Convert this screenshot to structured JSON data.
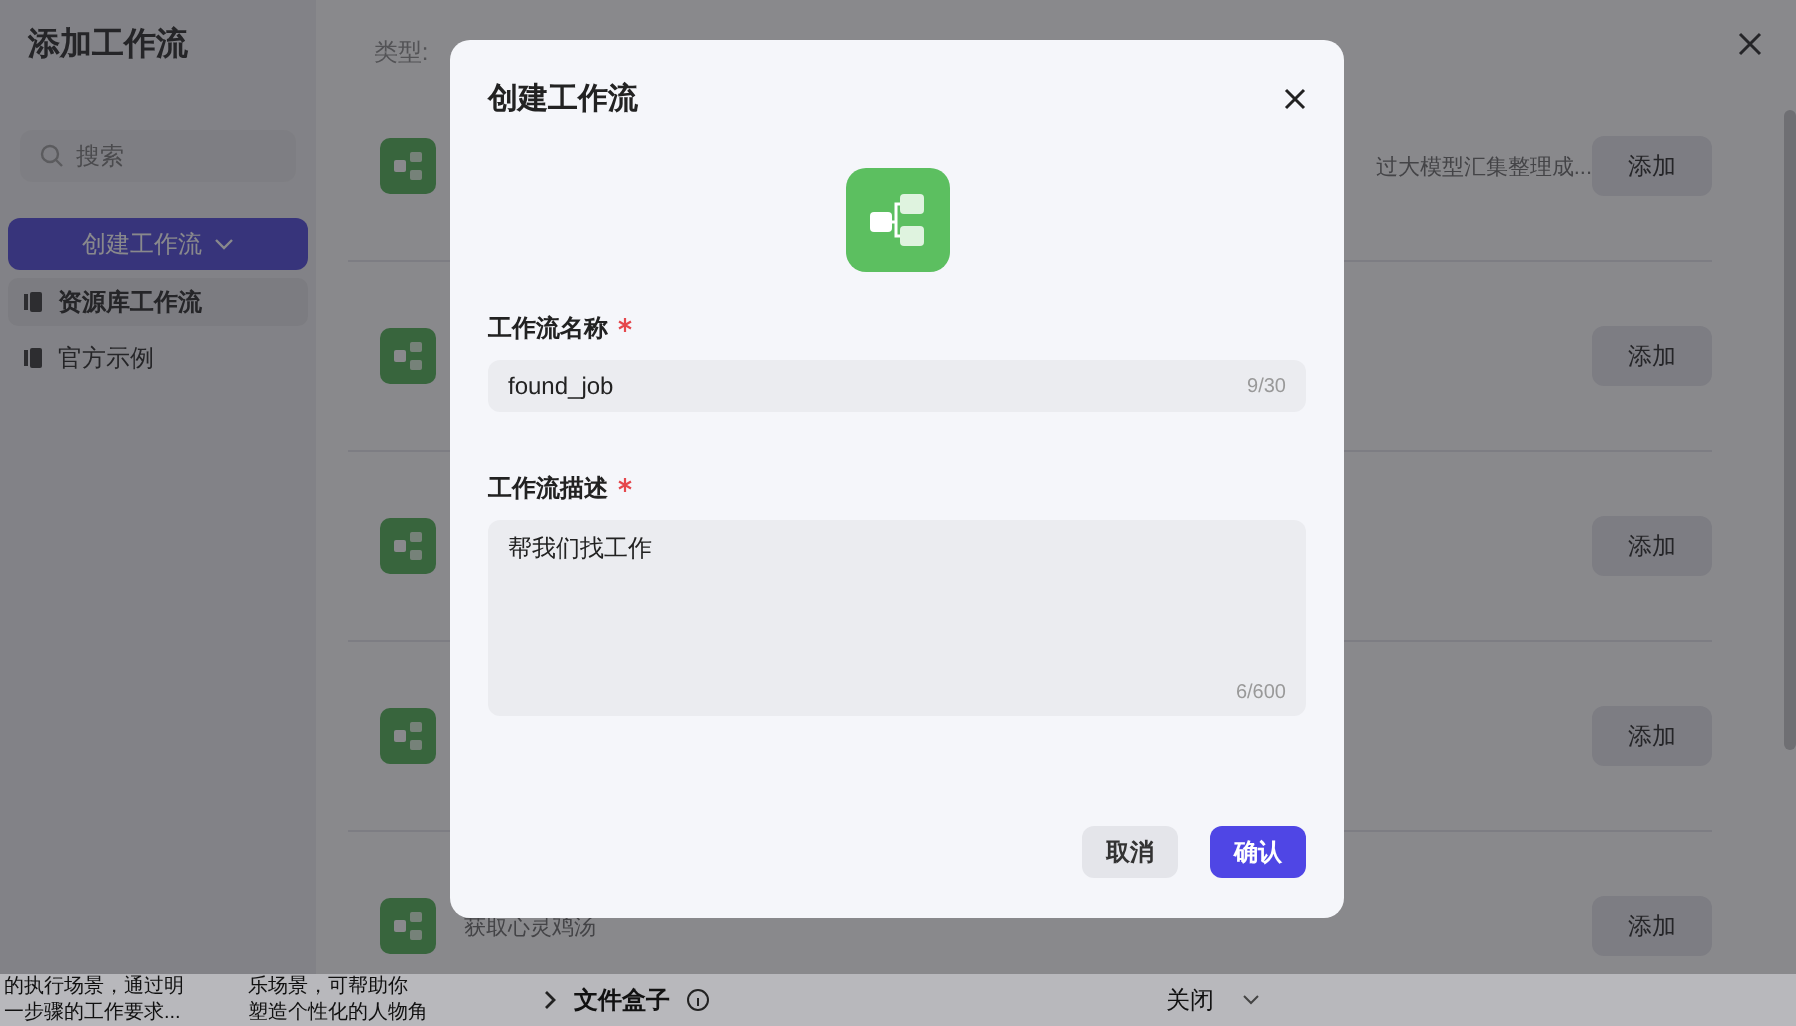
{
  "drawer": {
    "title": "添加工作流",
    "search": {
      "placeholder": "搜索"
    },
    "create_button": "创建工作流",
    "sidebar": {
      "items": [
        {
          "label": "资源库工作流",
          "selected": true
        },
        {
          "label": "官方示例",
          "selected": false
        }
      ]
    },
    "filter_label": "类型:",
    "rows": [
      {
        "description": "过大模型汇集整理成...",
        "action": "添加"
      },
      {
        "description": "",
        "action": "添加"
      },
      {
        "description": "",
        "action": "添加"
      },
      {
        "description": "",
        "action": "添加"
      },
      {
        "description": "获取心灵鸡汤",
        "action": "添加"
      }
    ]
  },
  "page_below": {
    "snippets": [
      {
        "lines": [
          "的执行场景，通过明",
          "一步骤的工作要求..."
        ]
      },
      {
        "lines": [
          "乐场景，可帮助你",
          "塑造个性化的人物角"
        ]
      }
    ],
    "section": {
      "title": "文件盒子",
      "value": "关闭"
    }
  },
  "dialog": {
    "title": "创建工作流",
    "fields": [
      {
        "kind": "input",
        "label": "工作流名称",
        "required": true,
        "value": "found_job",
        "counter": "9/30"
      },
      {
        "kind": "textarea",
        "label": "工作流描述",
        "required": true,
        "value": "帮我们找工作",
        "counter": "6/600"
      }
    ],
    "buttons": [
      {
        "label": "取消",
        "primary": false
      },
      {
        "label": "确认",
        "primary": true
      }
    ]
  }
}
